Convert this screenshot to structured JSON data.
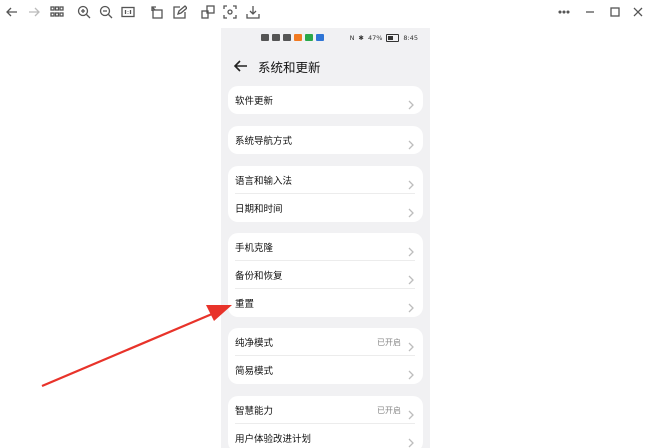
{
  "status_bar": {
    "battery": "47%",
    "time": "8:45"
  },
  "header": {
    "title": "系统和更新"
  },
  "groups": [
    {
      "rows": [
        {
          "label": "软件更新",
          "value": ""
        }
      ]
    },
    {
      "rows": [
        {
          "label": "系统导航方式",
          "value": ""
        }
      ]
    },
    {
      "rows": [
        {
          "label": "语言和输入法",
          "value": ""
        },
        {
          "label": "日期和时间",
          "value": ""
        }
      ]
    },
    {
      "rows": [
        {
          "label": "手机克隆",
          "value": ""
        },
        {
          "label": "备份和恢复",
          "value": ""
        },
        {
          "label": "重置",
          "value": ""
        }
      ]
    },
    {
      "rows": [
        {
          "label": "纯净模式",
          "value": "已开启"
        },
        {
          "label": "简易模式",
          "value": ""
        }
      ]
    },
    {
      "rows": [
        {
          "label": "智慧能力",
          "value": "已开启"
        },
        {
          "label": "用户体验改进计划",
          "value": ""
        }
      ]
    }
  ],
  "colors": {
    "annotation_arrow": "#e8332a",
    "page_bg": "#f1f1f3",
    "card_bg": "#ffffff"
  }
}
